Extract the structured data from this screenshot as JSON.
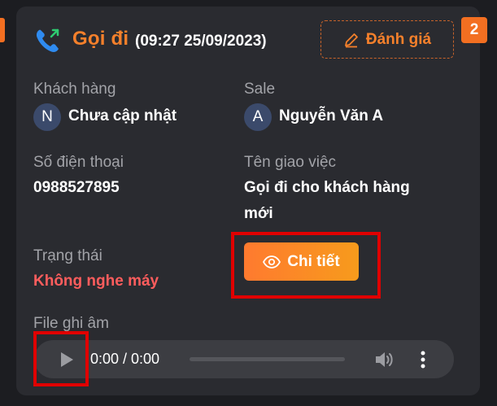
{
  "call": {
    "direction": "Gọi đi",
    "time": "(09:27 25/09/2023)",
    "rate_label": "Đánh giá",
    "badge_count": "2"
  },
  "customer": {
    "label": "Khách hàng",
    "avatar_initial": "N",
    "value": "Chưa cập nhật"
  },
  "sale": {
    "label": "Sale",
    "avatar_initial": "A",
    "value": "Nguyễn Văn A"
  },
  "phone": {
    "label": "Số điện thoại",
    "value": "0988527895"
  },
  "task": {
    "label": "Tên giao việc",
    "value_line1": "Gọi đi cho khách hàng",
    "value_line2": "mới"
  },
  "status": {
    "label": "Trạng thái",
    "value": "Không nghe máy"
  },
  "detail_button": {
    "label": "Chi tiết"
  },
  "recording": {
    "label": "File ghi âm",
    "time": "0:00 / 0:00",
    "progress": 0
  },
  "colors": {
    "accent": "#f5802b",
    "status_red": "#ff5d5d",
    "card_bg": "#2a2b30",
    "highlight": "#e00000"
  },
  "icons": [
    "phone-outgoing-icon",
    "pencil-icon",
    "eye-icon",
    "play-icon",
    "volume-icon",
    "more-vertical-icon"
  ]
}
